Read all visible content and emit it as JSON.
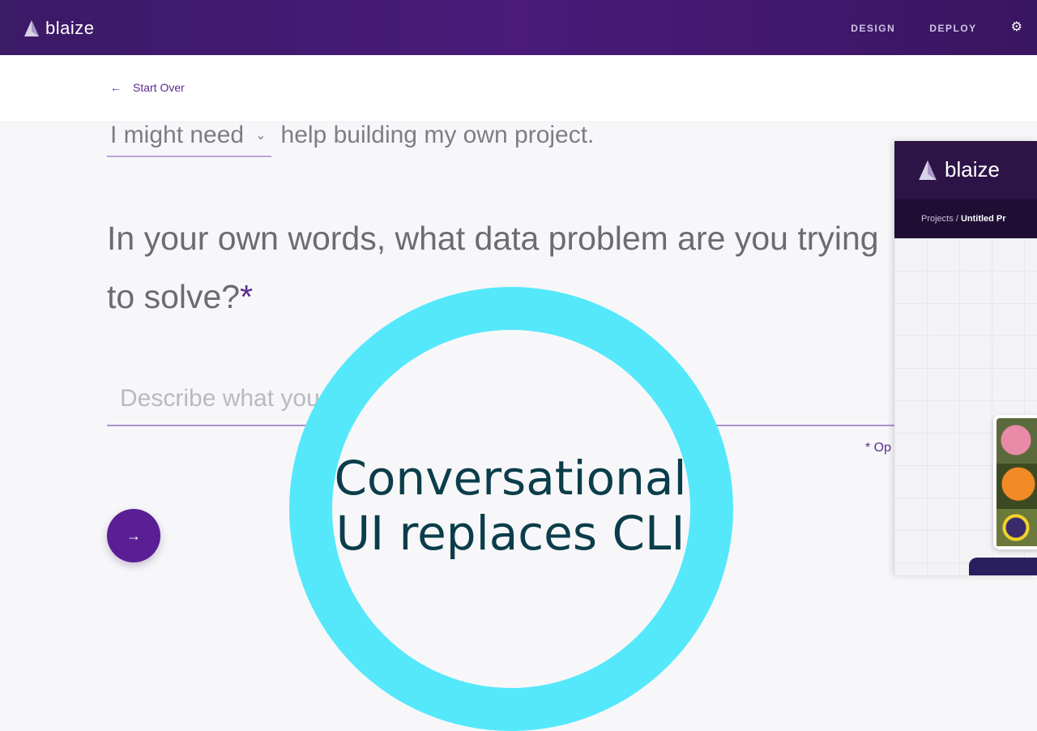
{
  "header": {
    "brand": "blaize",
    "nav": [
      {
        "label": "DESIGN"
      },
      {
        "label": "DEPLOY"
      }
    ]
  },
  "subheader": {
    "start_over_label": "Start Over"
  },
  "form": {
    "dropdown_value": "I might need",
    "sentence_rest": "help building my own project.",
    "question": "In your own words, what data problem are you trying to solve?",
    "required_mark": "*",
    "description_placeholder": "Describe what you wish to accomplish...",
    "optional_note": "* Op"
  },
  "overlay": {
    "line1": "Conversational",
    "line2": "UI replaces CLI",
    "ring_color": "#55e8fb"
  },
  "preview": {
    "brand": "blaize",
    "breadcrumb_root": "Projects",
    "breadcrumb_sep": "/",
    "breadcrumb_current": "Untitled Pr"
  },
  "colors": {
    "accent": "#5a1f94",
    "header_bg": "#3b1a66"
  }
}
